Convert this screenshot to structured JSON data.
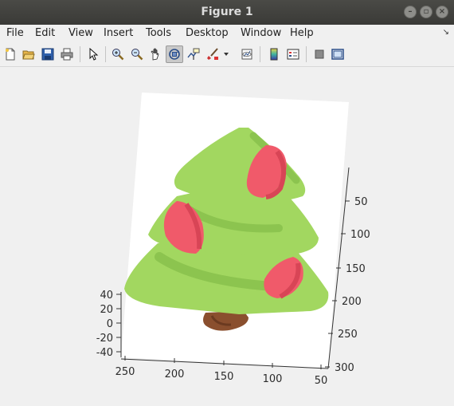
{
  "window": {
    "title": "Figure 1"
  },
  "menu": {
    "file": "File",
    "edit": "Edit",
    "view": "View",
    "insert": "Insert",
    "tools": "Tools",
    "desktop": "Desktop",
    "window": "Window",
    "help": "Help"
  },
  "toolbar": {
    "icons": [
      "new-figure-icon",
      "open-icon",
      "save-icon",
      "print-icon",
      "pointer-icon",
      "zoom-in-icon",
      "zoom-out-icon",
      "pan-icon",
      "rotate-3d-icon",
      "data-cursor-icon",
      "brush-icon",
      "dropdown-arrow-icon",
      "link-plot-icon",
      "colorbar-icon",
      "legend-icon",
      "hide-plot-tools-icon",
      "show-plot-tools-icon"
    ],
    "active": "rotate-3d-icon"
  },
  "axes": {
    "x_ticks": [
      "250",
      "200",
      "150",
      "100",
      "50"
    ],
    "y_ticks": [
      "50",
      "100",
      "150",
      "200",
      "250",
      "300"
    ],
    "z_ticks": [
      "40",
      "20",
      "0",
      "-20",
      "-40"
    ]
  },
  "image": {
    "subject": "christmas-tree",
    "colors": {
      "tree": "#a2d760",
      "tree_shade": "#8cc44f",
      "ornament": "#f05a6a",
      "ornament_shade": "#d84556",
      "trunk": "#8a4f2e",
      "plane": "#ffffff"
    }
  }
}
